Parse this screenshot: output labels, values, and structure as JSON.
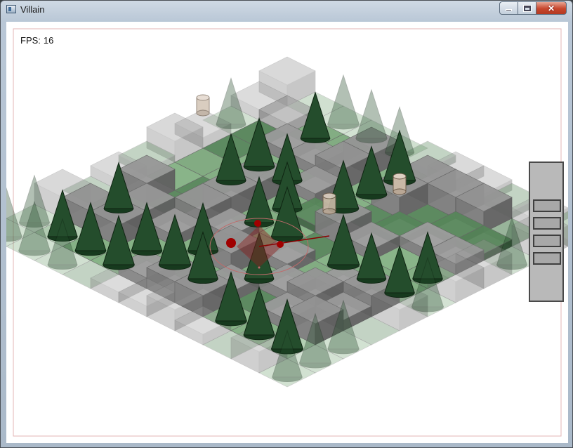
{
  "window": {
    "title": "Villain",
    "minimize_label": "",
    "maximize_label": "",
    "close_label": "✕"
  },
  "hud": {
    "fps_label": "FPS:",
    "fps_value": "16"
  },
  "side_panel": {
    "slot_count": 4
  },
  "colors": {
    "grass": "#7aa37a",
    "stone": "#9a9a9a",
    "tree": "#214a2a",
    "selection": "#8b0000"
  },
  "icons": {
    "app": "app-window-icon",
    "minimize": "minimize-icon",
    "maximize": "maximize-icon",
    "close": "close-icon"
  }
}
